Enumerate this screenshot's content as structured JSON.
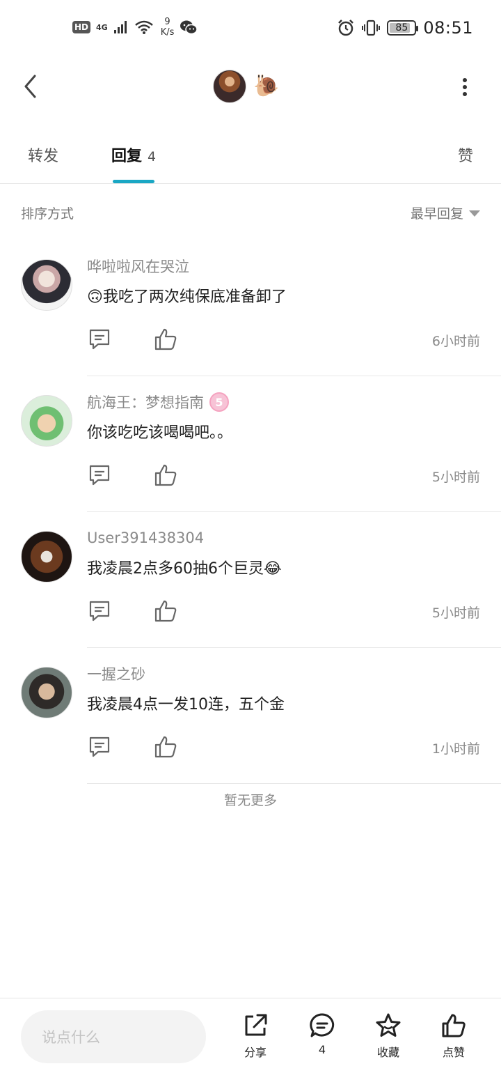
{
  "status_bar": {
    "hd": "HD",
    "network": "4G",
    "net_speed_value": "9",
    "net_speed_unit": "K/s",
    "battery": "85",
    "battery_level": 0.85,
    "time": "08:51",
    "icons": [
      "signal-icon",
      "wifi-icon",
      "wechat-icon",
      "alarm-icon",
      "vibrate-icon",
      "battery-icon"
    ]
  },
  "header": {
    "back_icon": "chevron-left-icon",
    "avatar_icon": "user-avatar",
    "emoji": "🐌",
    "more_icon": "more-vertical-icon"
  },
  "tabs": {
    "forward": "转发",
    "reply": "回复",
    "reply_count": "4",
    "like": "赞",
    "accent": "#1aa7c4"
  },
  "sort": {
    "label": "排序方式",
    "value": "最早回复"
  },
  "comments": [
    {
      "author": "哗啦啦风在哭泣",
      "text": "🙃我吃了两次纯保底准备卸了",
      "time": "6小时前"
    },
    {
      "author": "航海王：梦想指南",
      "badge": "5",
      "text": "你该吃吃该喝喝吧。。",
      "time": "5小时前"
    },
    {
      "author": "User391438304",
      "text": "我凌晨2点多60抽6个巨灵😂",
      "time": "5小时前"
    },
    {
      "author": "一握之砂",
      "text": "我凌晨4点一发10连，五个金",
      "time": "1小时前"
    }
  ],
  "no_more": "暂无更多",
  "bottom_bar": {
    "input_placeholder": "说点什么",
    "share": "分享",
    "comment_count": "4",
    "favorite": "收藏",
    "like": "点赞"
  }
}
